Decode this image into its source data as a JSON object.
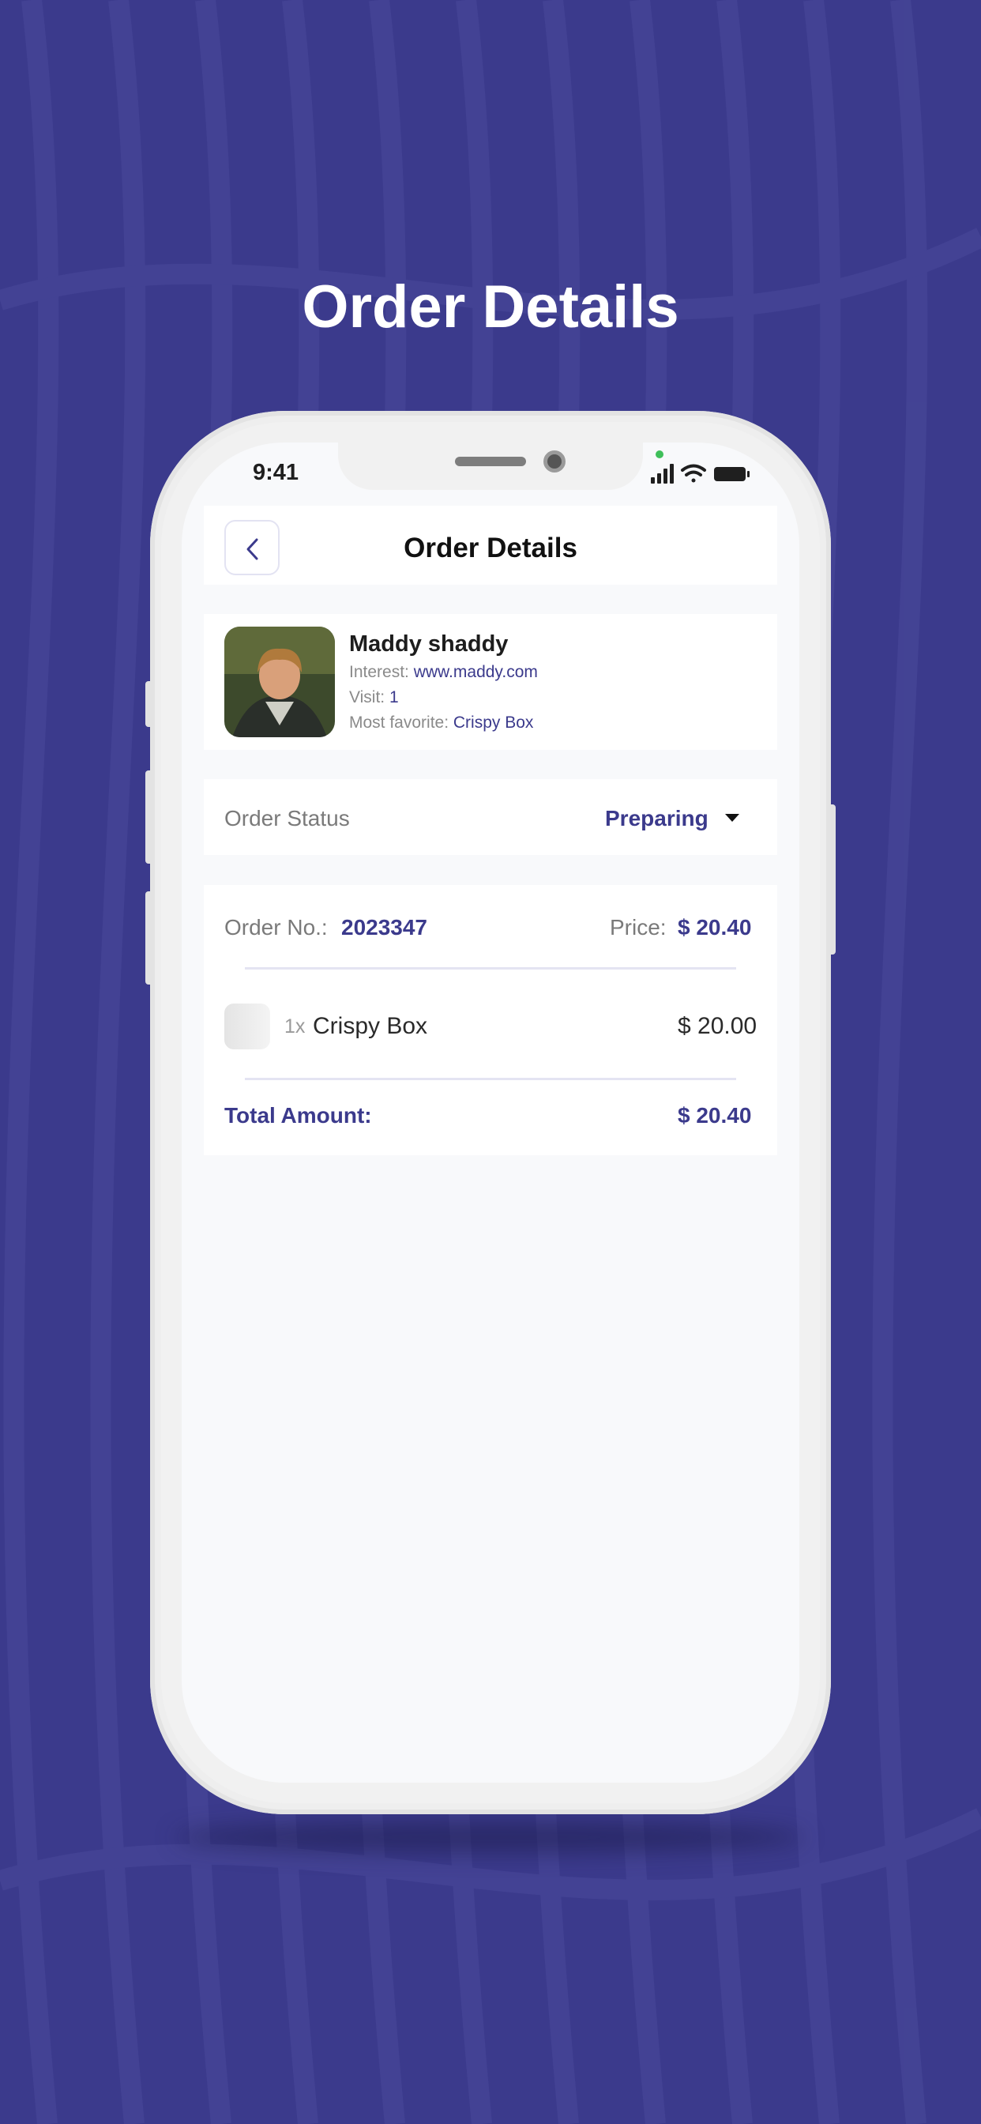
{
  "colors": {
    "background": "#3b3a8c",
    "accent": "#3b3a8c",
    "phone_frame": "#eeeeee",
    "screen": "#f8f9fb"
  },
  "headline": "Order Details",
  "status_bar": {
    "time": "9:41",
    "icons": [
      "cellular-signal-icon",
      "wifi-icon",
      "battery-icon"
    ]
  },
  "navbar": {
    "back_icon": "chevron-left-icon",
    "title": "Order Details"
  },
  "customer": {
    "name": "Maddy shaddy",
    "interest_label": "Interest:",
    "interest_value": "www.maddy.com",
    "visit_label": "Visit:",
    "visit_value": "1",
    "favorite_label": "Most favorite:",
    "favorite_value": "Crispy Box"
  },
  "order_status": {
    "label": "Order Status",
    "value": "Preparing",
    "caret_icon": "caret-down-icon"
  },
  "order": {
    "number_label": "Order No.:",
    "number_value": "2023347",
    "price_label": "Price:",
    "price_value": "$ 20.40",
    "items": [
      {
        "qty": "1x",
        "name": "Crispy Box",
        "price": "$ 20.00"
      }
    ],
    "total_label": "Total Amount:",
    "total_value": "$ 20.40"
  }
}
